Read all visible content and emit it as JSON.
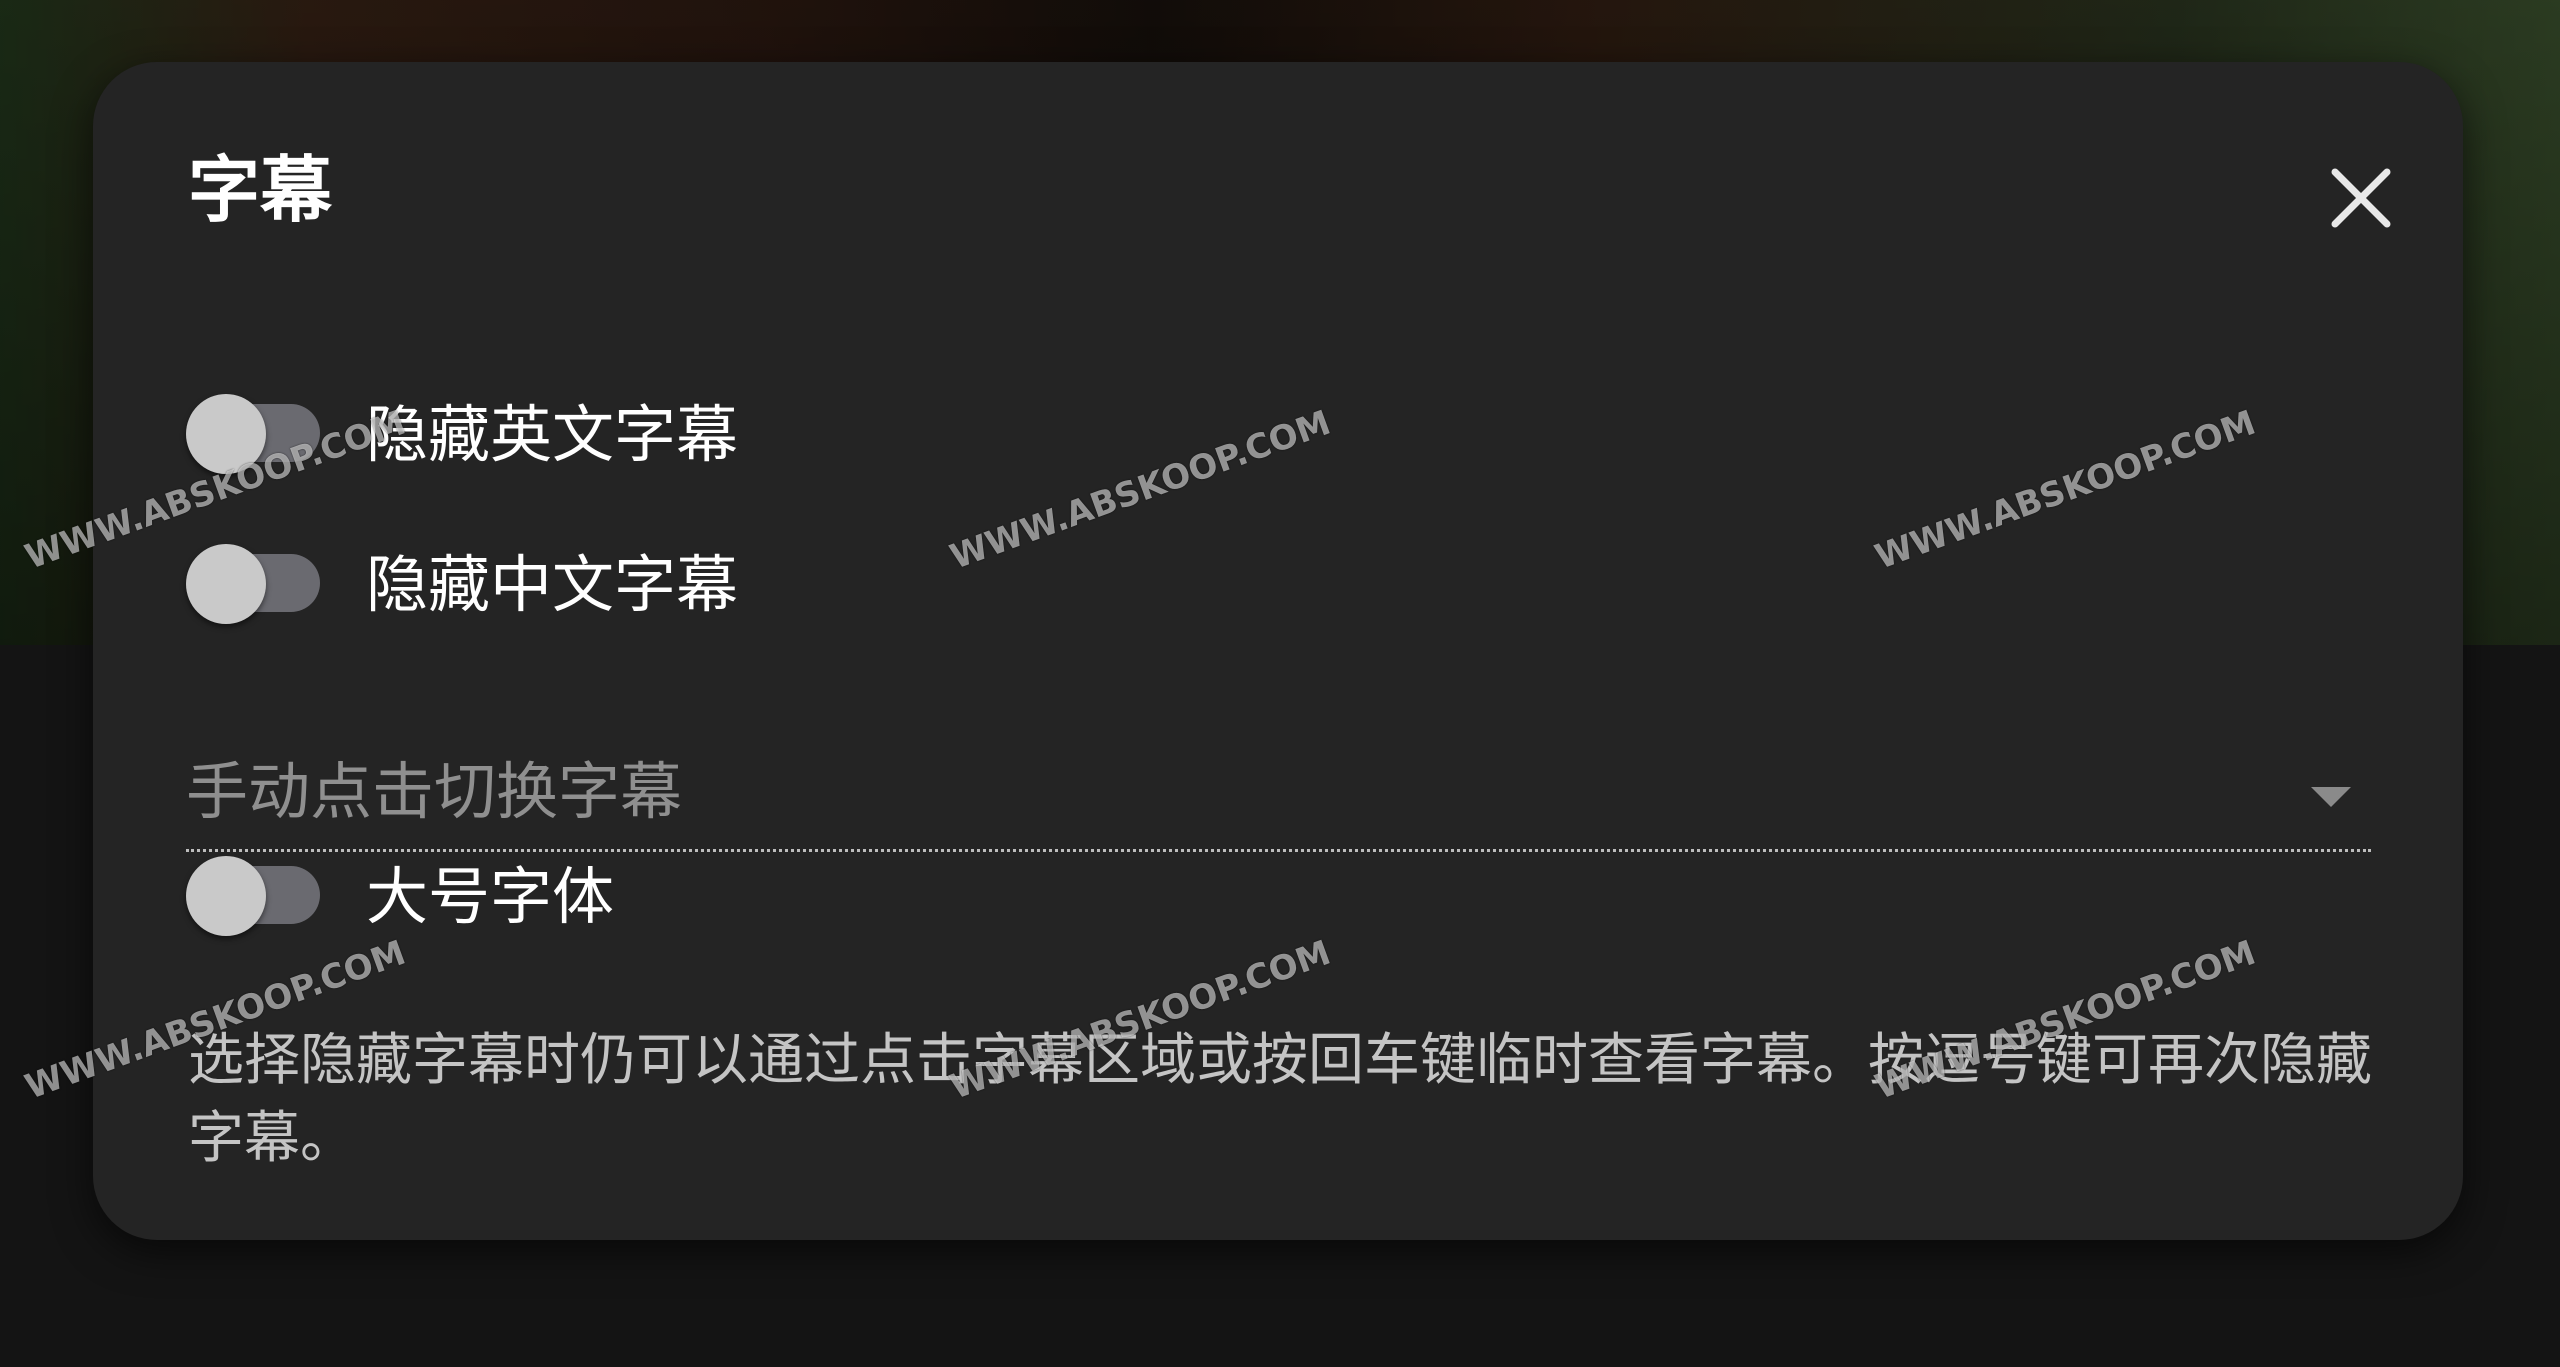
{
  "dialog": {
    "title": "字幕",
    "close_icon": "close-icon",
    "toggles": [
      {
        "label": "隐藏英文字幕",
        "on": false
      },
      {
        "label": "隐藏中文字幕",
        "on": false
      }
    ],
    "subtitle_mode": {
      "value": "手动点击切换字幕",
      "icon": "chevron-down-icon"
    },
    "large_font": {
      "label": "大号字体",
      "on": false
    },
    "note": "选择隐藏字幕时仍可以通过点击字幕区域或按回车键临时查看字幕。按逗号键可再次隐藏字幕。"
  },
  "watermark": "WWW.ABSKOOP.COM",
  "colors": {
    "dialog_bg": "#242424",
    "switch_track": "#6a6a70",
    "switch_thumb": "#c9c9c9",
    "text_primary": "#ffffff",
    "text_secondary": "#8f8f8f"
  }
}
